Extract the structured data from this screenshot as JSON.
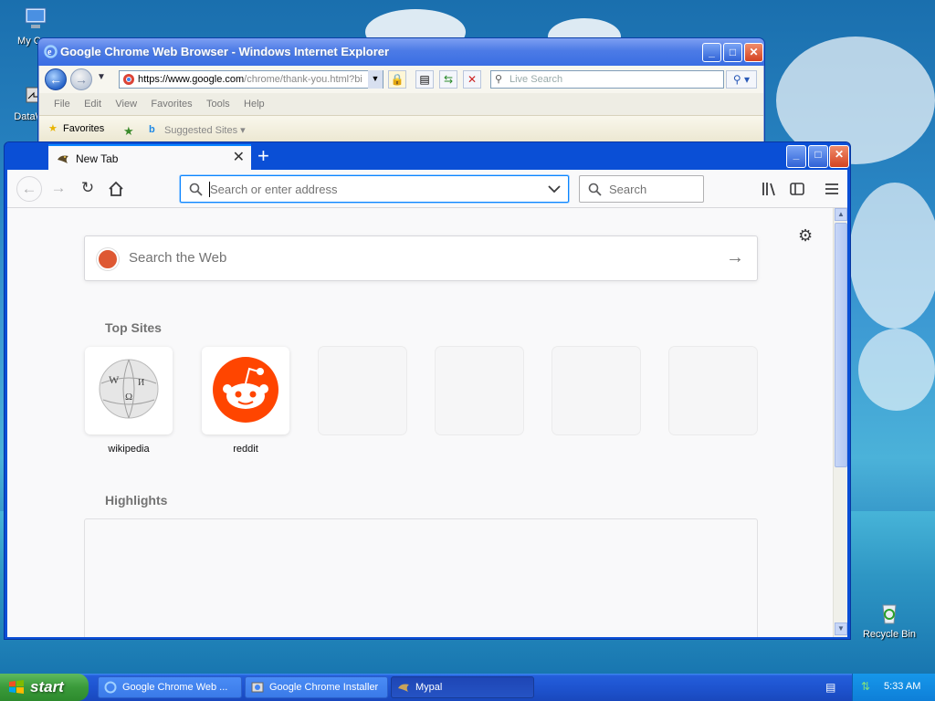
{
  "desktop": {
    "icons": [
      {
        "label": "My Con"
      },
      {
        "label": "DataWa"
      },
      {
        "label": "Recycle Bin"
      }
    ]
  },
  "ie": {
    "title": "Google Chrome Web Browser - Windows Internet Explorer",
    "address_host": "https://www.google.com",
    "address_path": "/chrome/thank-you.html?bi",
    "live_search_placeholder": "Live Search",
    "menu": [
      "File",
      "Edit",
      "View",
      "Favorites",
      "Tools",
      "Help"
    ],
    "favorites_label": "Favorites",
    "suggested_label": "Suggested Sites"
  },
  "firefox": {
    "tab_title": "New Tab",
    "url_placeholder": "Search or enter address",
    "search_placeholder": "Search",
    "web_search_placeholder": "Search the Web",
    "top_sites_title": "Top Sites",
    "highlights_title": "Highlights",
    "top_sites": [
      {
        "label": "wikipedia"
      },
      {
        "label": "reddit"
      }
    ]
  },
  "taskbar": {
    "start_label": "start",
    "items": [
      {
        "label": "Google Chrome Web ..."
      },
      {
        "label": "Google Chrome Installer"
      },
      {
        "label": "Mypal"
      }
    ],
    "clock": "5:33 AM"
  },
  "colors": {
    "xp_blue": "#0a4fd6",
    "start_green": "#3a9a3a",
    "reddit_orange": "#ff4500",
    "ddg_orange": "#de5833",
    "firefox_focus": "#0a84ff"
  }
}
